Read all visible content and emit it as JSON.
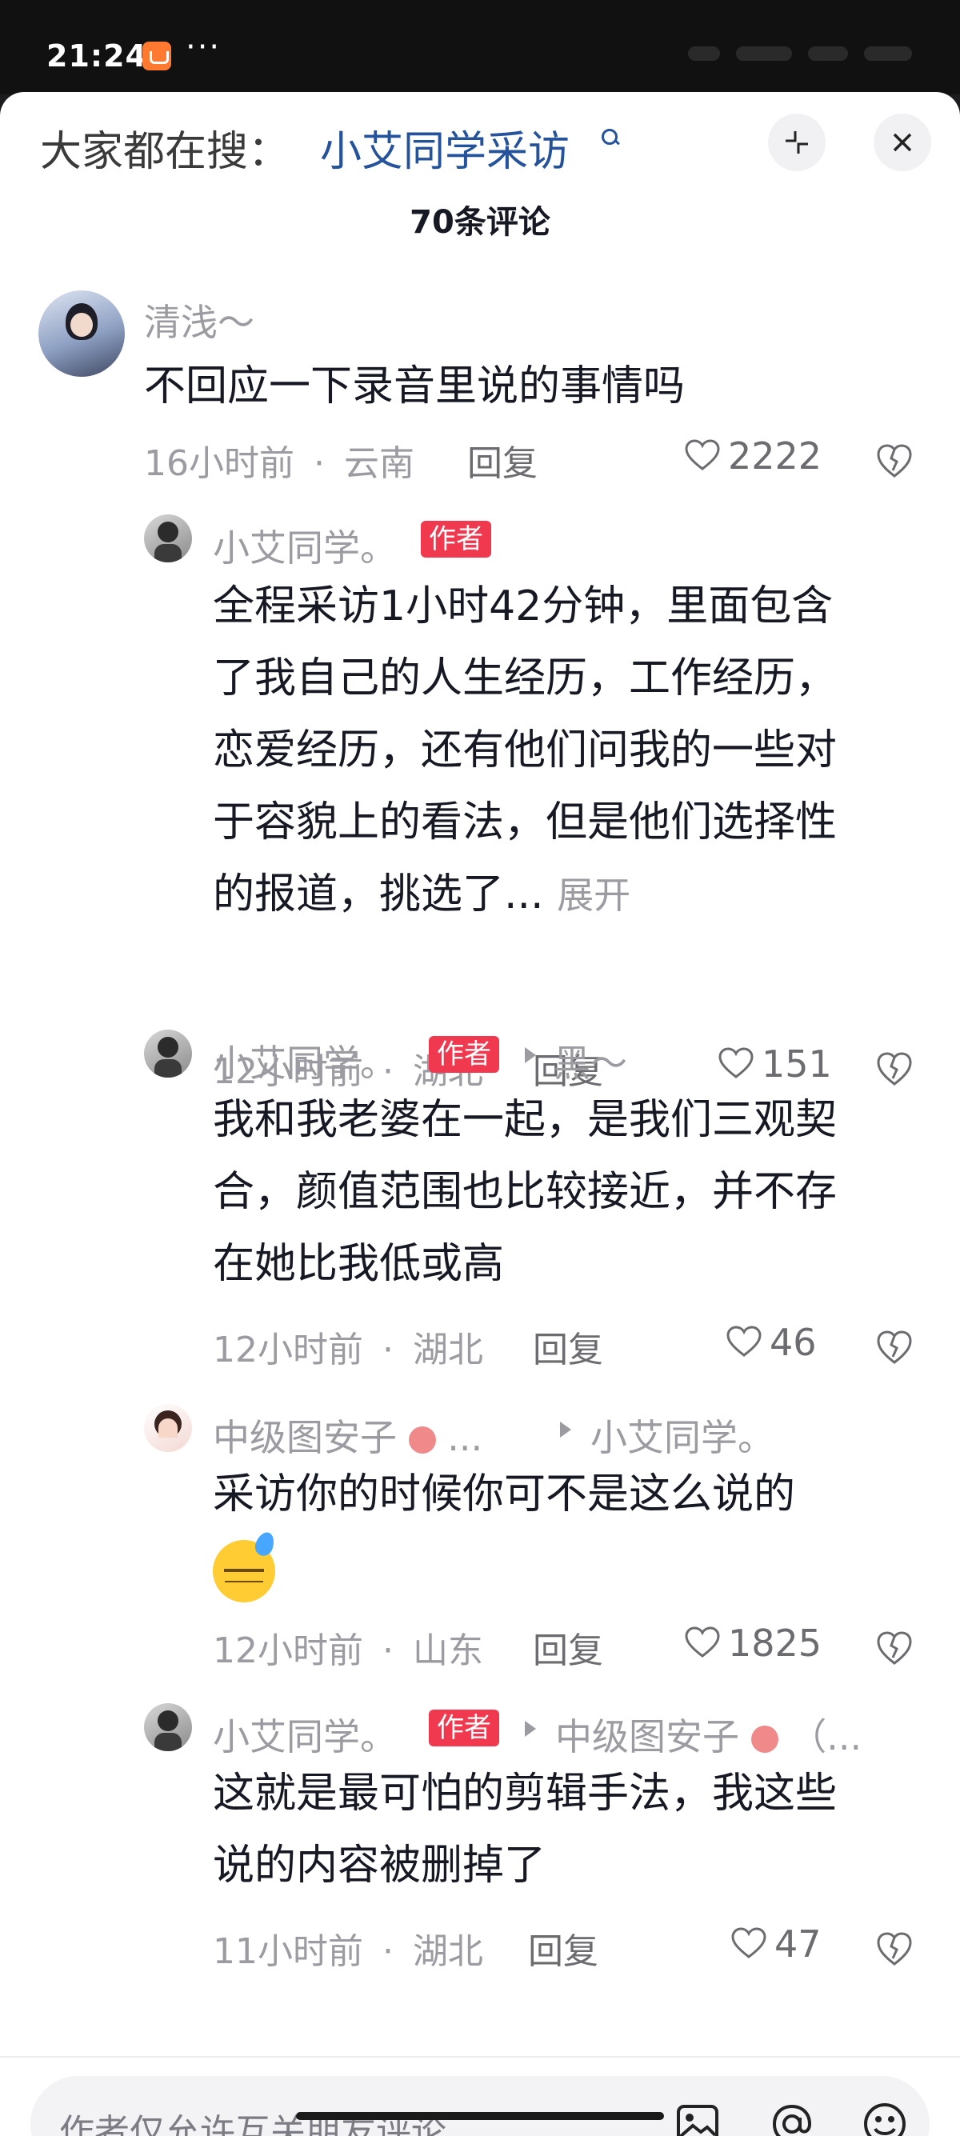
{
  "status_bar": {
    "time": "21:24",
    "dots": "···"
  },
  "header": {
    "search_prefix": "大家都在搜：",
    "search_term": "小艾同学采访",
    "comment_count": "70条评论"
  },
  "comments": [
    {
      "name": "清浅～",
      "text": "不回应一下录音里说的事情吗",
      "time": "16小时前",
      "location": "云南",
      "reply_label": "回复",
      "likes": "2222"
    },
    {
      "name": "小艾同学。",
      "badge": "作者",
      "lines": [
        "全程采访1小时42分钟，里面包含",
        "了我自己的人生经历，工作经历，",
        "恋爱经历，还有他们问我的一些对",
        "于容貌上的看法，但是他们选择性"
      ],
      "last_line": "的报道，挑选了...",
      "expand": "展开",
      "time": "12小时前",
      "location": "湖北",
      "reply_label": "回复",
      "likes": "151"
    },
    {
      "name": "小艾同学。",
      "badge": "作者",
      "reply_to": "黑～",
      "lines": [
        "我和我老婆在一起，是我们三观契",
        "合，颜值范围也比较接近，并不存",
        "在她比我低或高"
      ],
      "time": "12小时前",
      "location": "湖北",
      "reply_label": "回复",
      "likes": "46"
    },
    {
      "name": "中级图安子",
      "name_suffix": "...",
      "reply_to": "小艾同学。",
      "text": "采访你的时候你可不是这么说的",
      "time": "12小时前",
      "location": "山东",
      "reply_label": "回复",
      "likes": "1825"
    },
    {
      "name": "小艾同学。",
      "badge": "作者",
      "reply_to": "中级图安子",
      "reply_to_suffix": "（...",
      "lines": [
        "这就是最可怕的剪辑手法，我这些",
        "说的内容被删掉了"
      ],
      "time": "11小时前",
      "location": "湖北",
      "reply_label": "回复",
      "likes": "47"
    }
  ],
  "meta_separator": "·",
  "input_bar": {
    "placeholder": "作者仅允许互关朋友评论"
  },
  "colors": {
    "badge": "#f0384e",
    "search_term": "#24539c",
    "muted": "#9b9ba1"
  }
}
